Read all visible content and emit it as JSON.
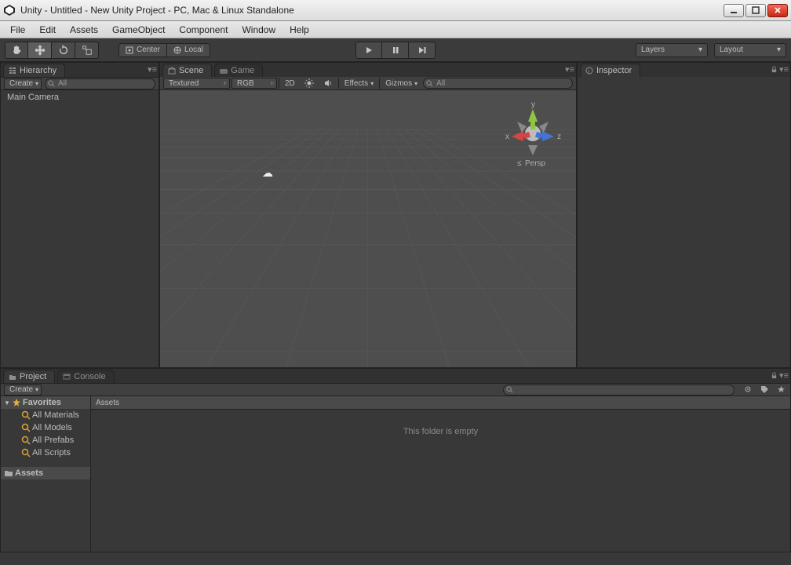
{
  "window": {
    "title": "Unity - Untitled - New Unity Project - PC, Mac & Linux Standalone"
  },
  "menubar": [
    "File",
    "Edit",
    "Assets",
    "GameObject",
    "Component",
    "Window",
    "Help"
  ],
  "toolbar": {
    "pivot_center": "Center",
    "pivot_local": "Local",
    "layers": "Layers",
    "layout": "Layout"
  },
  "hierarchy": {
    "tab": "Hierarchy",
    "create": "Create",
    "search_placeholder": "All",
    "items": [
      "Main Camera"
    ]
  },
  "scene": {
    "tab_scene": "Scene",
    "tab_game": "Game",
    "shading": "Textured",
    "rgb": "RGB",
    "twod": "2D",
    "effects": "Effects",
    "gizmos": "Gizmos",
    "search_placeholder": "All",
    "axis_x": "x",
    "axis_y": "y",
    "axis_z": "z",
    "persp": "Persp"
  },
  "inspector": {
    "tab": "Inspector"
  },
  "project": {
    "tab_project": "Project",
    "tab_console": "Console",
    "create": "Create",
    "favorites": "Favorites",
    "fav_items": [
      "All Materials",
      "All Models",
      "All Prefabs",
      "All Scripts"
    ],
    "assets": "Assets",
    "crumb": "Assets",
    "empty": "This folder is empty"
  }
}
